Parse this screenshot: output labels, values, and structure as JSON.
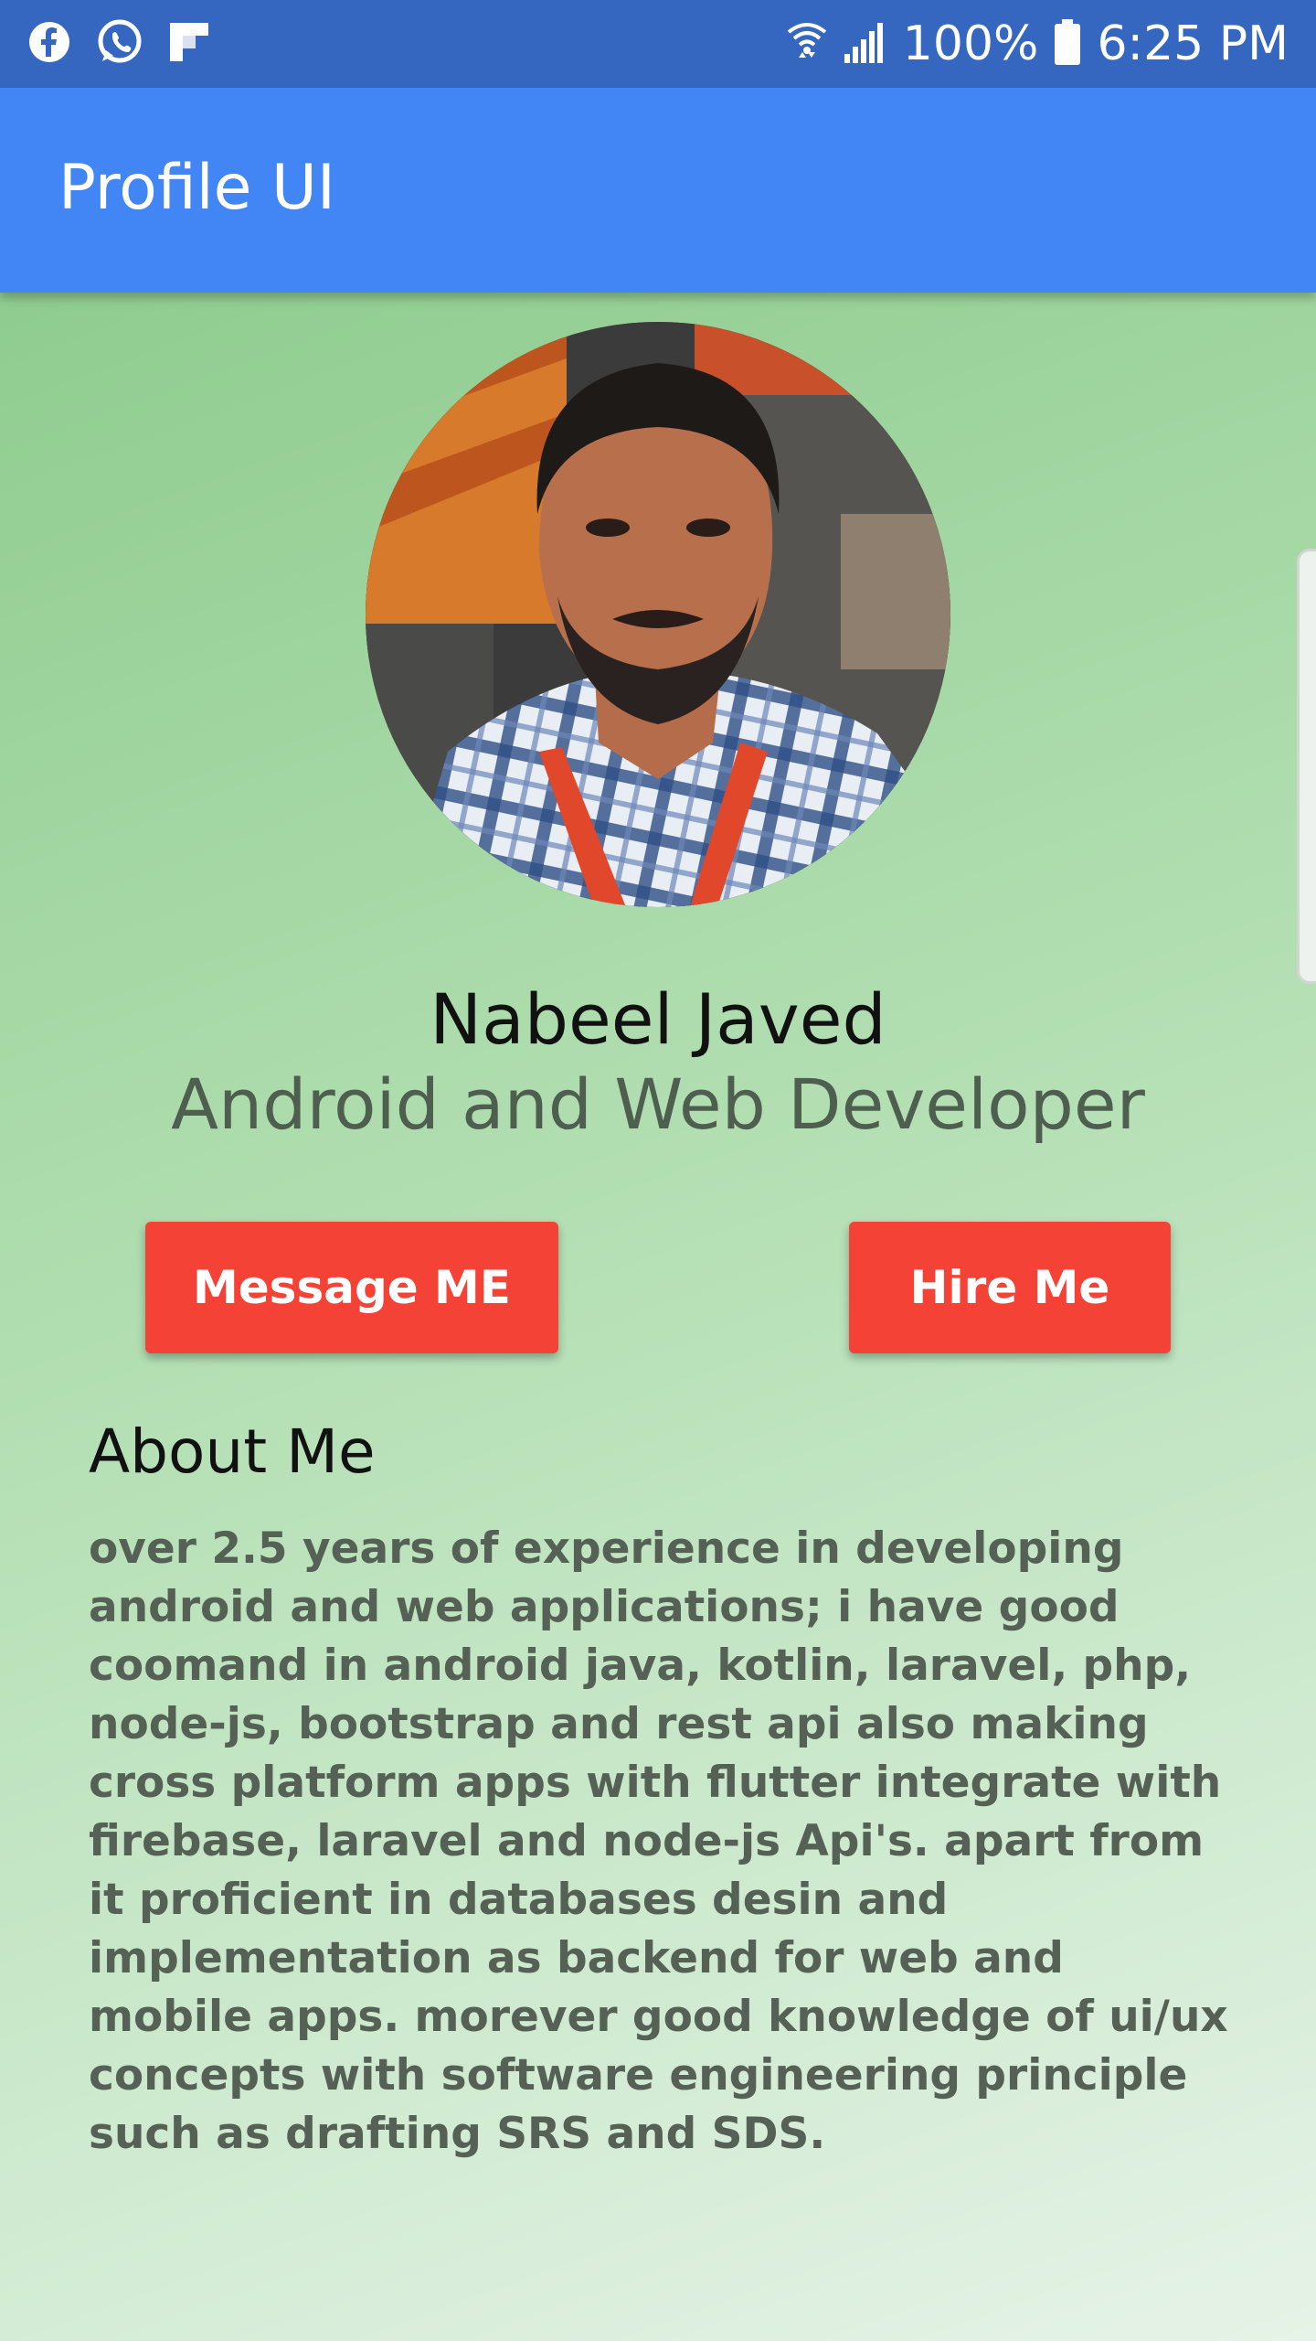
{
  "status_bar": {
    "icons_left": [
      "facebook-icon",
      "whatsapp-icon",
      "flipboard-icon"
    ],
    "icons_right": [
      "wifi-icon",
      "signal-icon",
      "battery-icon"
    ],
    "battery": "100%",
    "time": "6:25 PM"
  },
  "app_bar": {
    "title": "Profile UI"
  },
  "profile": {
    "name": "Nabeel Javed",
    "role": "Android and Web Developer",
    "avatar": "profile-photo"
  },
  "actions": {
    "message_label": "Message ME",
    "hire_label": "Hire Me"
  },
  "about": {
    "title": "About Me",
    "text": "over 2.5 years of experience in developing android and web applications; i have good coomand in android java, kotlin, laravel, php, node-js, bootstrap and rest api also making cross platform apps with flutter integrate with firebase, laravel and node-js Api's. apart from it proficient in databases desin and implementation as backend for web and mobile apps. morever good knowledge of ui/ux concepts with software engineering principle such as drafting SRS and SDS."
  },
  "colors": {
    "status_bar": "#3567c0",
    "app_bar": "#4285f4",
    "button": "#f44336",
    "background_start": "#8fcc8f",
    "background_end": "#e6f3e8"
  }
}
